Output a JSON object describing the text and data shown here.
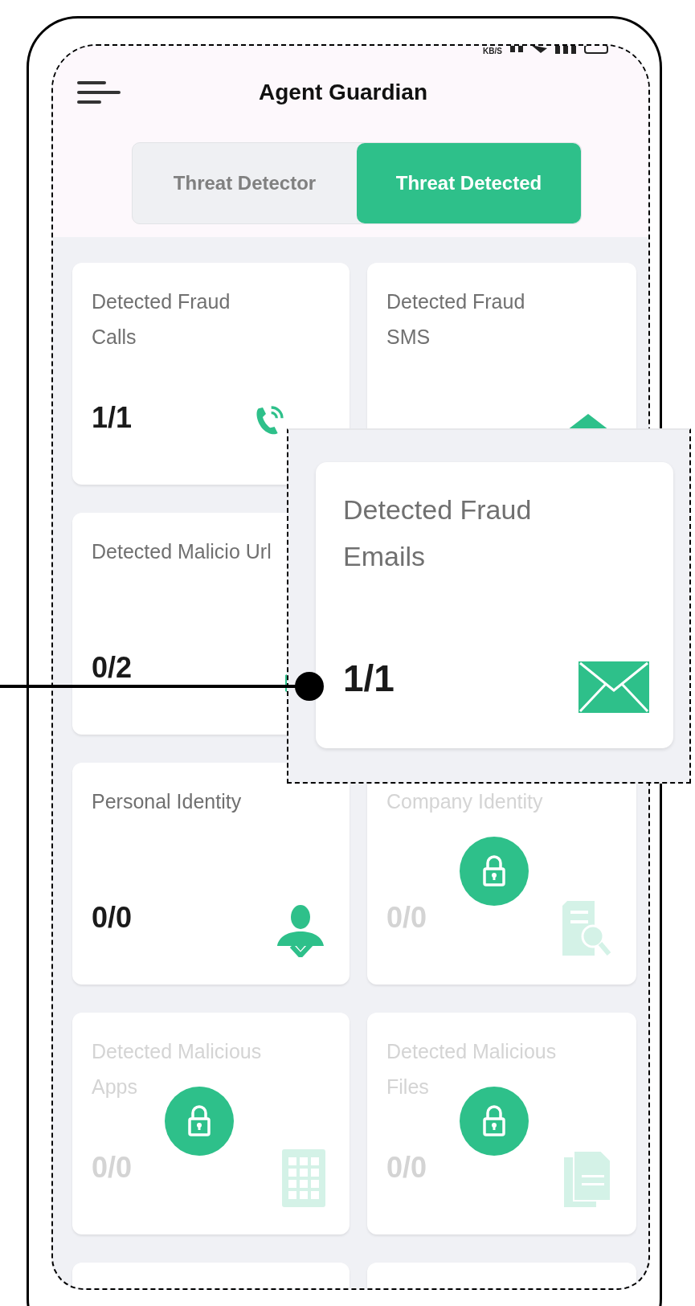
{
  "status_bar": {
    "speed_unit": "KB/S"
  },
  "header": {
    "title": "Agent Guardian"
  },
  "tabs": [
    {
      "label": "Threat Detector",
      "selected": false
    },
    {
      "label": "Threat Detected",
      "selected": true
    }
  ],
  "cards": [
    {
      "kind": "calls",
      "title": "Detected Fraud Calls",
      "value": "1/1",
      "locked": false
    },
    {
      "kind": "sms",
      "title": "Detected Fraud SMS",
      "locked": false
    },
    {
      "kind": "url",
      "title": "Detected Malicio Url",
      "value": "0/2",
      "locked": false
    },
    {
      "kind": "blank"
    },
    {
      "kind": "personal",
      "title": "Personal Identity",
      "value": "0/0",
      "locked": false
    },
    {
      "kind": "company",
      "title": "Company Identity",
      "value": "0/0",
      "locked": true
    },
    {
      "kind": "apps",
      "title": "Detected Malicious Apps",
      "value": "0/0",
      "locked": true
    },
    {
      "kind": "files",
      "title": "Detected Malicious Files",
      "value": "0/0",
      "locked": true
    }
  ],
  "callout": {
    "title": "Detected Fraud Emails",
    "value": "1/1"
  }
}
